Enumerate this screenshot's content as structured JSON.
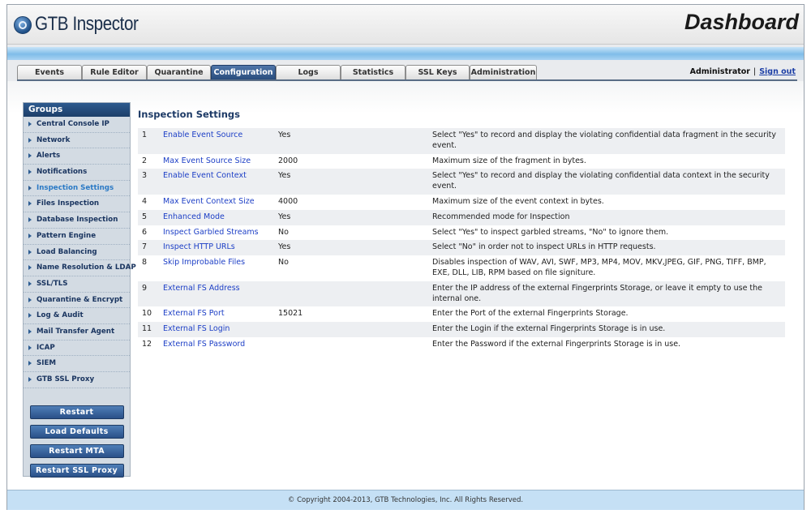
{
  "app": {
    "title": "GTB Inspector",
    "page_heading": "Dashboard"
  },
  "tabs": [
    {
      "label": "Events",
      "active": false
    },
    {
      "label": "Rule Editor",
      "active": false
    },
    {
      "label": "Quarantine",
      "active": false
    },
    {
      "label": "Configuration",
      "active": true
    },
    {
      "label": "Logs",
      "active": false
    },
    {
      "label": "Statistics",
      "active": false
    },
    {
      "label": "SSL Keys",
      "active": false
    },
    {
      "label": "Administration",
      "active": false
    }
  ],
  "user": {
    "name": "Administrator",
    "separator": "|",
    "signout": "Sign out"
  },
  "sidebar": {
    "title": "Groups",
    "items": [
      {
        "label": "Central Console IP"
      },
      {
        "label": "Network"
      },
      {
        "label": "Alerts"
      },
      {
        "label": "Notifications"
      },
      {
        "label": "Inspection Settings",
        "active": true
      },
      {
        "label": "Files Inspection"
      },
      {
        "label": "Database Inspection"
      },
      {
        "label": "Pattern Engine"
      },
      {
        "label": "Load Balancing"
      },
      {
        "label": "Name Resolution & LDAP"
      },
      {
        "label": "SSL/TLS"
      },
      {
        "label": "Quarantine & Encrypt"
      },
      {
        "label": "Log & Audit"
      },
      {
        "label": "Mail Transfer Agent"
      },
      {
        "label": "ICAP"
      },
      {
        "label": "SIEM"
      },
      {
        "label": "GTB SSL Proxy"
      }
    ],
    "buttons": [
      {
        "label": "Restart"
      },
      {
        "label": "Load Defaults"
      },
      {
        "label": "Restart MTA"
      },
      {
        "label": "Restart SSL Proxy"
      }
    ]
  },
  "main": {
    "title": "Inspection Settings",
    "rows": [
      {
        "num": "1",
        "name": "Enable Event Source",
        "value": "Yes",
        "desc": "Select \"Yes\" to record and display the violating confidential data fragment in the security event."
      },
      {
        "num": "2",
        "name": "Max Event Source Size",
        "value": "2000",
        "desc": "Maximum size of the fragment in bytes."
      },
      {
        "num": "3",
        "name": "Enable Event Context",
        "value": "Yes",
        "desc": "Select \"Yes\" to record and display the violating confidential data context in the security event."
      },
      {
        "num": "4",
        "name": "Max Event Context Size",
        "value": "4000",
        "desc": "Maximum size of the event context in bytes."
      },
      {
        "num": "5",
        "name": "Enhanced Mode",
        "value": "Yes",
        "desc": "Recommended mode for Inspection"
      },
      {
        "num": "6",
        "name": "Inspect Garbled Streams",
        "value": "No",
        "desc": "Select \"Yes\" to inspect garbled streams, \"No\" to ignore them."
      },
      {
        "num": "7",
        "name": "Inspect HTTP URLs",
        "value": "Yes",
        "desc": "Select \"No\" in order not to inspect URLs in HTTP requests."
      },
      {
        "num": "8",
        "name": "Skip Improbable Files",
        "value": "No",
        "desc": "Disables inspection of WAV, AVI, SWF, MP3, MP4, MOV, MKV,JPEG, GIF, PNG, TIFF, BMP, EXE, DLL, LIB, RPM based on file signiture."
      },
      {
        "num": "9",
        "name": "External FS Address",
        "value": "",
        "desc": "Enter the IP address of the external Fingerprints Storage, or leave it empty to use the internal one."
      },
      {
        "num": "10",
        "name": "External FS Port",
        "value": "15021",
        "desc": "Enter the Port of the external Fingerprints Storage."
      },
      {
        "num": "11",
        "name": "External FS Login",
        "value": "",
        "desc": "Enter the Login if the external Fingerprints Storage is in use."
      },
      {
        "num": "12",
        "name": "External FS Password",
        "value": "",
        "desc": "Enter the Password if the external Fingerprints Storage is in use."
      }
    ]
  },
  "footer": {
    "copyright": "© Copyright 2004-2013, GTB Technologies, Inc. All Rights Reserved."
  }
}
